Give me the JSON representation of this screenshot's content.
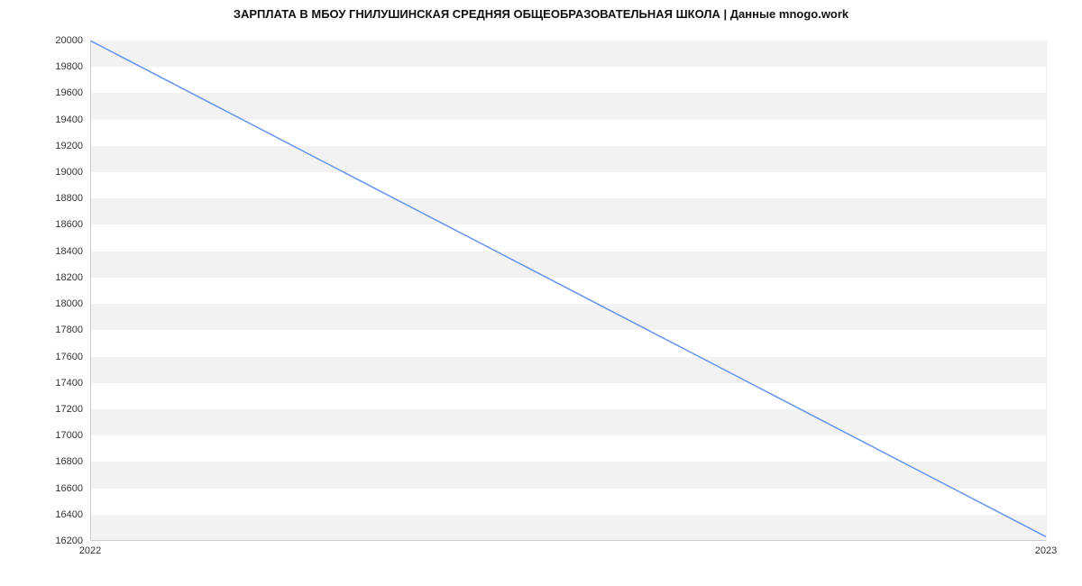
{
  "chart_data": {
    "type": "line",
    "title": "ЗАРПЛАТА В МБОУ ГНИЛУШИНСКАЯ СРЕДНЯЯ ОБЩЕОБРАЗОВАТЕЛЬНАЯ ШКОЛА | Данные mnogo.work",
    "x": [
      "2022",
      "2023"
    ],
    "values": [
      20000,
      16232
    ],
    "xlabel": "",
    "ylabel": "",
    "ylim": [
      16200,
      20000
    ],
    "y_ticks": [
      16200,
      16400,
      16600,
      16800,
      17000,
      17200,
      17400,
      17600,
      17800,
      18000,
      18200,
      18400,
      18600,
      18800,
      19000,
      19200,
      19400,
      19600,
      19800,
      20000
    ],
    "x_ticks": [
      "2022",
      "2023"
    ],
    "line_color": "#6495ed"
  }
}
